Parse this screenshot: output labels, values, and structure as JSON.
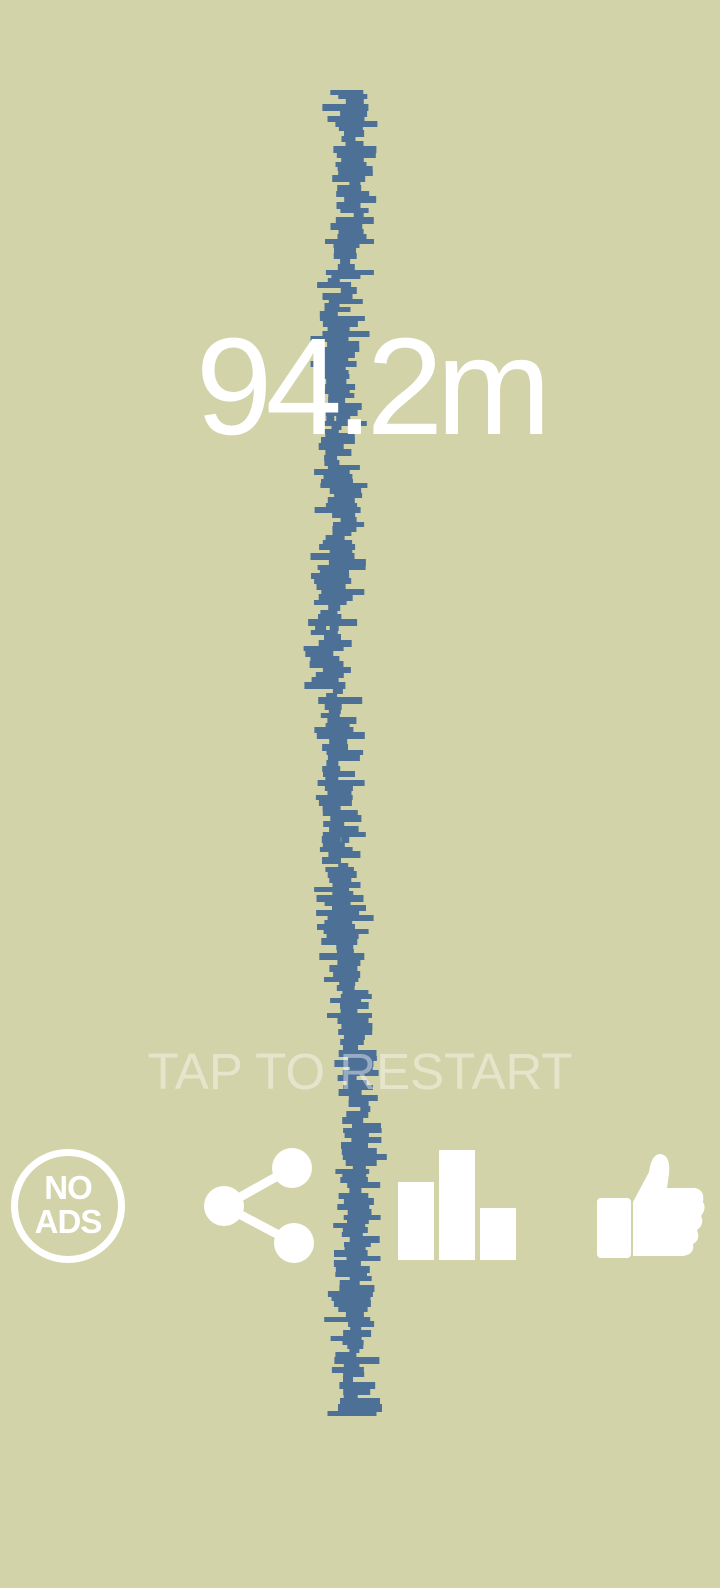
{
  "game": {
    "score": "94.2m",
    "restart_prompt": "TAP TO RESTART"
  },
  "buttons": {
    "no_ads": {
      "line1": "NO",
      "line2": "ADS",
      "icon": "no-ads-icon"
    },
    "share": {
      "icon": "share-icon"
    },
    "leaderboard": {
      "icon": "leaderboard-bar-chart-icon"
    },
    "rate": {
      "icon": "thumbs-up-icon"
    }
  },
  "colors": {
    "background": "#d2d3a8",
    "tower_blocks": "#4d7096",
    "foreground": "#ffffff"
  }
}
